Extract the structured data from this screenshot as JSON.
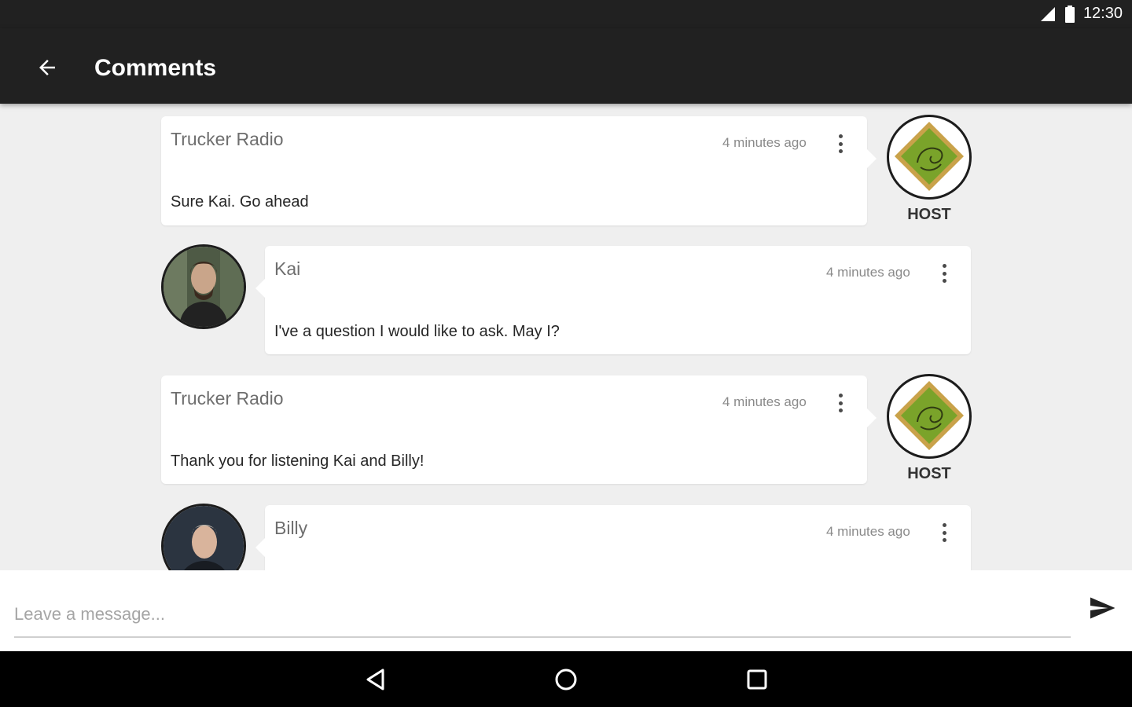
{
  "status": {
    "time": "12:30"
  },
  "appbar": {
    "title": "Comments"
  },
  "comments": [
    {
      "author": "Trucker Radio",
      "time": "4 minutes ago",
      "message": "Sure Kai. Go ahead",
      "role": "HOST"
    },
    {
      "author": "Kai",
      "time": "4 minutes ago",
      "message": "I've a question I would like to ask. May I?"
    },
    {
      "author": "Trucker Radio",
      "time": "4 minutes ago",
      "message": "Thank you for listening Kai and Billy!",
      "role": "HOST"
    },
    {
      "author": "Billy",
      "time": "4 minutes ago",
      "message": ""
    }
  ],
  "composer": {
    "placeholder": "Leave a message...",
    "value": ""
  },
  "colors": {
    "bar": "#212121",
    "background": "#efefef",
    "host_green": "#7aa32a",
    "host_gold": "#c9a24a"
  }
}
